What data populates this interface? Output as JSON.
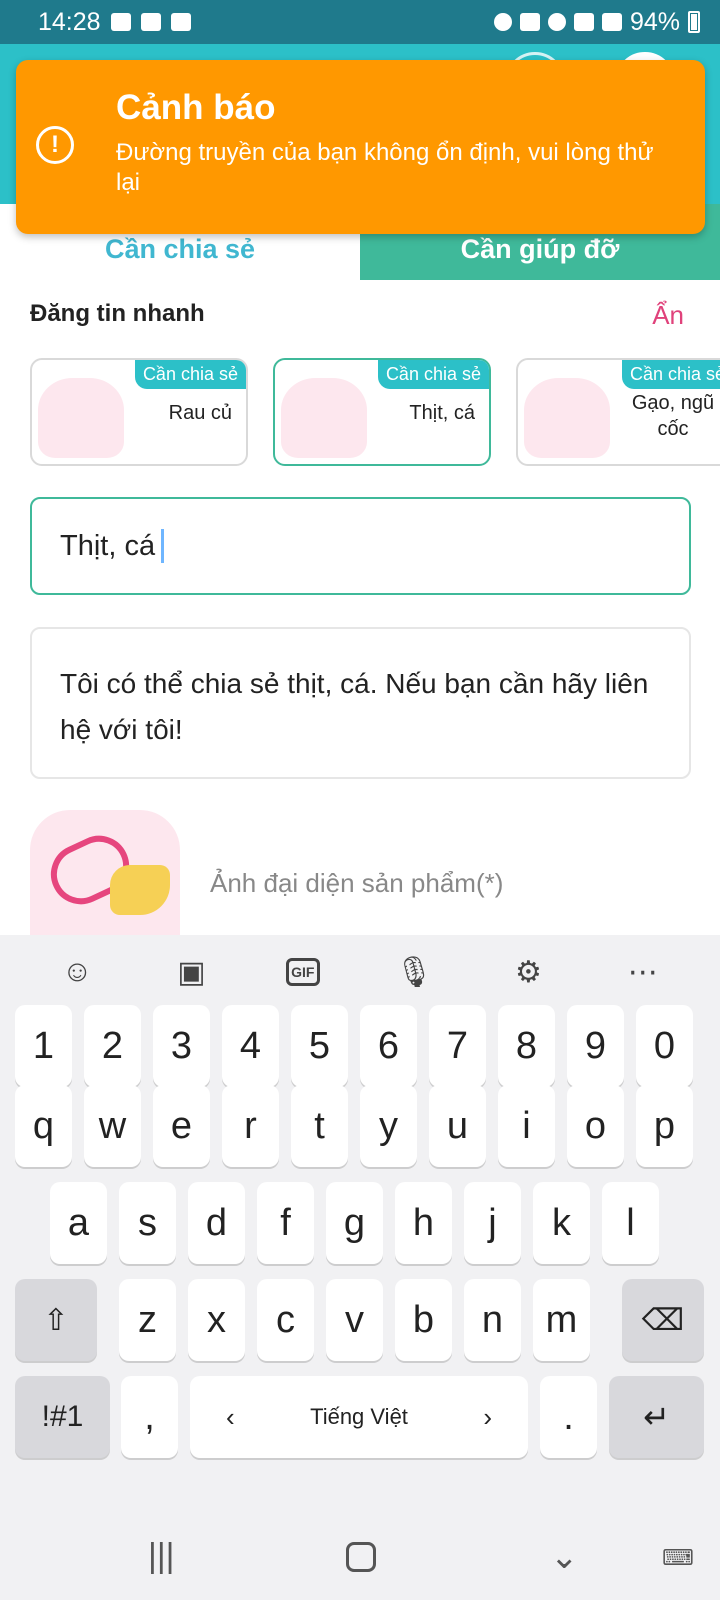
{
  "status_bar": {
    "time": "14:28",
    "battery": "94%"
  },
  "tabs": [
    {
      "label": "Cần chia sẻ",
      "active": false
    },
    {
      "label": "Cần giúp đỡ",
      "active": true
    }
  ],
  "toast": {
    "title": "Cảnh báo",
    "message": "Đường truyền của bạn không ổn định, vui lòng thử lại",
    "icon": "exclamation-circle-icon",
    "color": "#ff9800"
  },
  "quick_post": {
    "title": "Đăng tin nhanh",
    "hide_label": "Ẩn",
    "cards": [
      {
        "badge": "Cần chia sẻ",
        "label": "Rau củ",
        "selected": false
      },
      {
        "badge": "Cần chia sẻ",
        "label": "Thịt, cá",
        "selected": true
      },
      {
        "badge": "Cần chia sẻ",
        "label": "Gạo, ngũ cốc",
        "selected": false
      }
    ]
  },
  "form": {
    "title_value": "Thịt, cá",
    "description": "Tôi có thể chia sẻ thịt, cá. Nếu bạn cần hãy liên hệ với tôi!",
    "image_label": "Ảnh đại diện sản phẩm(*)"
  },
  "keyboard": {
    "row_numbers": [
      "1",
      "2",
      "3",
      "4",
      "5",
      "6",
      "7",
      "8",
      "9",
      "0"
    ],
    "row1": [
      "q",
      "w",
      "e",
      "r",
      "t",
      "y",
      "u",
      "i",
      "o",
      "p"
    ],
    "row2": [
      "a",
      "s",
      "d",
      "f",
      "g",
      "h",
      "j",
      "k",
      "l"
    ],
    "row3": [
      "z",
      "x",
      "c",
      "v",
      "b",
      "n",
      "m"
    ],
    "symbols_label": "!#1",
    "comma": ",",
    "space_label": "Tiếng Việt",
    "period": "."
  },
  "colors": {
    "accent": "#2cc0c8",
    "green": "#3fb99a",
    "pink": "#e0427b"
  }
}
